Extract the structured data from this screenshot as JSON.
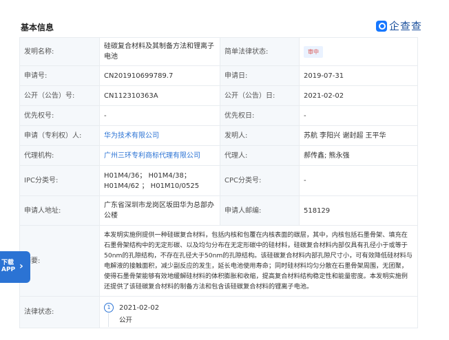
{
  "header": {
    "section_title": "基本信息",
    "logo_text": "企查查"
  },
  "rows": {
    "r1": {
      "l1": "发明名称:",
      "v1": "硅碳复合材料及其制备方法和锂离子电池",
      "l2": "简单法律状态:",
      "v2": "审中"
    },
    "r2": {
      "l1": "申请号:",
      "v1": "CN201910699789.7",
      "l2": "申请日:",
      "v2": "2019-07-31"
    },
    "r3": {
      "l1": "公开（公告）号:",
      "v1": "CN112310363A",
      "l2": "公开（公告）日:",
      "v2": "2021-02-02"
    },
    "r4": {
      "l1": "优先权号:",
      "v1": "-",
      "l2": "优先权日:",
      "v2": "-"
    },
    "r5": {
      "l1": "申请（专利权）人:",
      "v1": "华为技术有限公司",
      "l2": "发明人:",
      "v2": "苏航 李阳兴 谢封超 王平华"
    },
    "r6": {
      "l1": "代理机构:",
      "v1": "广州三环专利商标代理有限公司",
      "l2": "代理人:",
      "v2": "郝传鑫; 熊永强"
    },
    "r7": {
      "l1": "IPC分类号:",
      "v1": "H01M4/36； H01M4/38； H01M4/62 ； H01M10/0525",
      "l2": "CPC分类号:",
      "v2": "-"
    },
    "r8": {
      "l1": "申请人地址:",
      "v1": "广东省深圳市龙岗区坂田华为总部办公楼",
      "l2": "申请人邮编:",
      "v2": "518129"
    },
    "abstract": {
      "label": "摘要:",
      "text": "本发明实施例提供一种硅碳复合材料，包括内核和包覆在内核表面的碳层，其中，内核包括石墨骨架、填充在石墨骨架结构中的无定形碳、以及均匀分布在无定形碳中的硅材料，硅碳复合材料内部仅具有孔径小于或等于50nm的孔隙结构，不存在孔径大于50nm的孔隙结构。该硅碳复合材料内部孔隙尺寸小，可有效降低硅材料与电解液的接触面积，减少副反应的发生，延长电池使用寿命；同时硅材料均匀分散在石墨骨架周围，无团聚，使得石墨骨架能够有效地缓解硅材料的体积膨胀和收缩，提高复合材料结构稳定性和能量密度。本发明实施例还提供了该硅碳复合材料的制备方法和包含该硅碳复合材料的锂离子电池。"
    },
    "legal": {
      "label": "法律状态:",
      "step_num": "1",
      "date": "2021-02-02",
      "status": "公开"
    }
  },
  "app_button": {
    "line1": "下载",
    "line2": "APP",
    "arrow": "›"
  },
  "colors": {
    "link": "#2b73d4",
    "label_bg": "#f5f8fb",
    "status": "#d9534f"
  }
}
